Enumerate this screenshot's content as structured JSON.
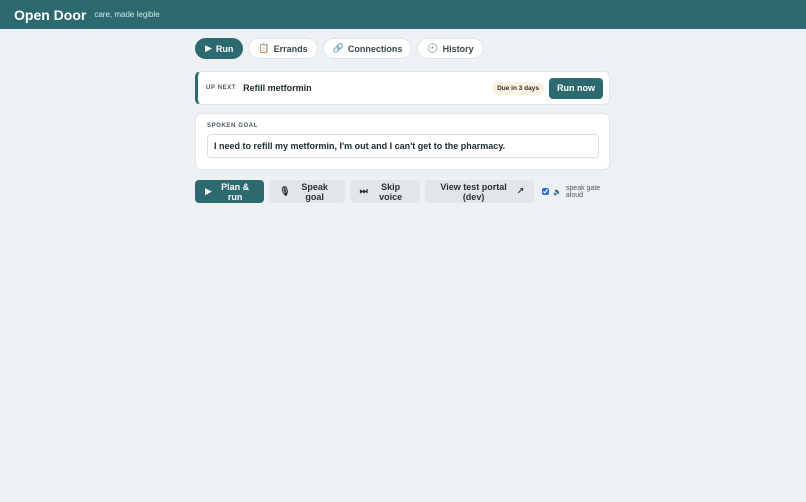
{
  "header": {
    "brand": "Open Door",
    "tagline": "care, made legible"
  },
  "tabs": [
    {
      "label": "Run",
      "icon": "▶",
      "icon_name": "play-icon",
      "active": true
    },
    {
      "label": "Errands",
      "icon": "📋",
      "icon_name": "clipboard-icon",
      "active": false
    },
    {
      "label": "Connections",
      "icon": "🔗",
      "icon_name": "link-icon",
      "active": false
    },
    {
      "label": "History",
      "icon": "🕘",
      "icon_name": "clock-icon",
      "active": false
    }
  ],
  "up_next": {
    "label": "UP NEXT",
    "title": "Refill metformin",
    "due": "Due in 3 days",
    "run_label": "Run now"
  },
  "goal": {
    "label": "SPOKEN GOAL",
    "value": "I need to refill my metformin, I'm out and I can't get to the pharmacy."
  },
  "actions": {
    "plan_icon": "▶",
    "plan_label": "Plan & run",
    "speak_icon": "🎙",
    "speak_label": "Speak goal",
    "skip_icon": "⏭",
    "skip_label": "Skip voice",
    "portal_label": "View test portal (dev)",
    "portal_icon": "↗",
    "speak_gate_icon": "🔈",
    "speak_gate_label": "speak gate aloud",
    "speak_gate_checked": true
  },
  "colors": {
    "brand": "#2d6a70",
    "background": "#eef1f3",
    "due_badge": "#fbf1e1"
  }
}
